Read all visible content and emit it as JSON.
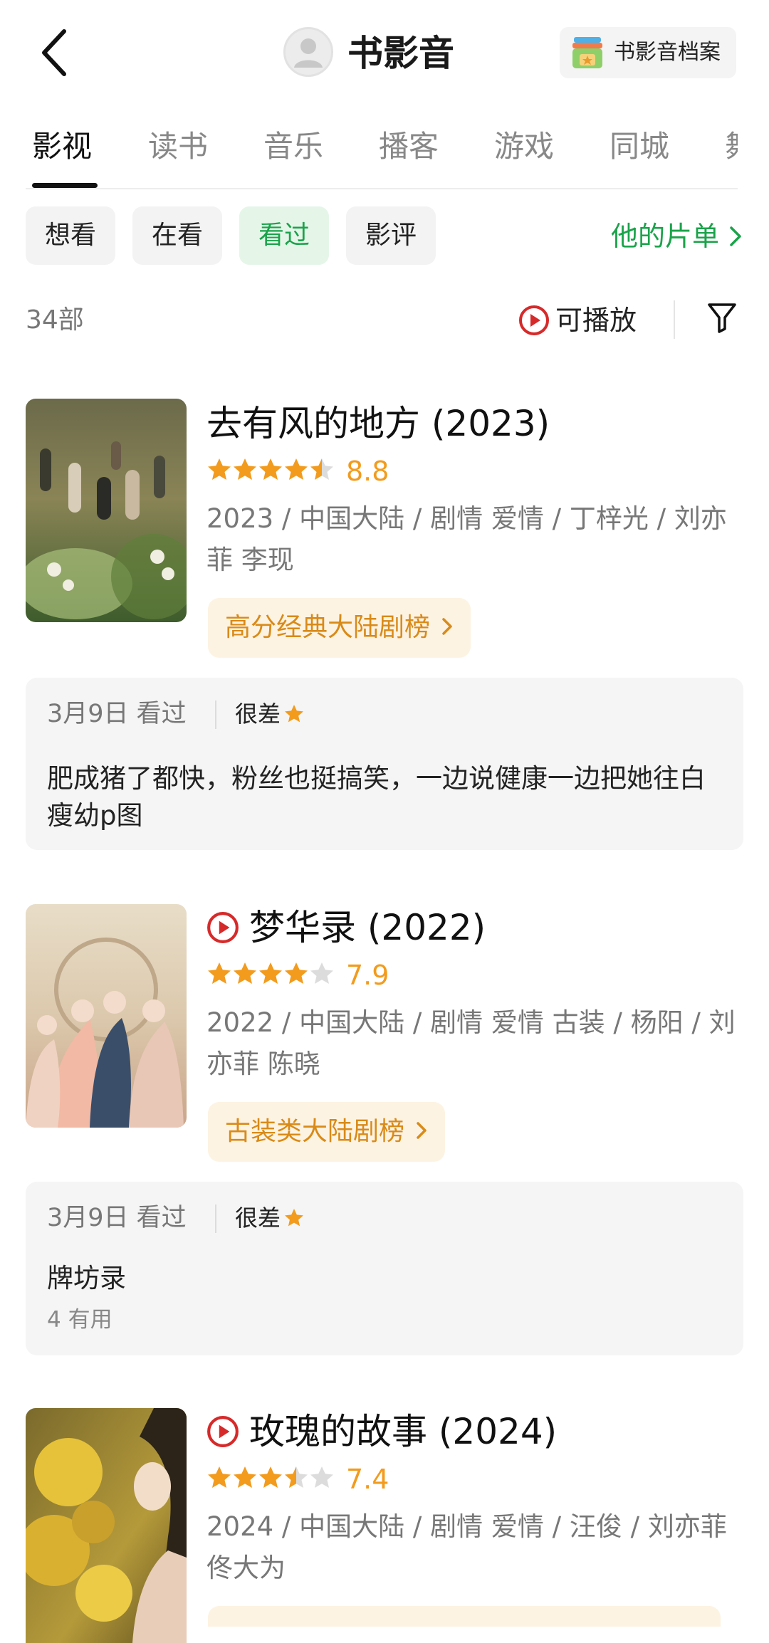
{
  "header": {
    "title": "书影音",
    "archive_label": "书影音档案"
  },
  "tabs": [
    "影视",
    "读书",
    "音乐",
    "播客",
    "游戏",
    "同城",
    "舞"
  ],
  "active_tab": "影视",
  "filters": [
    "想看",
    "在看",
    "看过",
    "影评"
  ],
  "active_filter": "看过",
  "my_list_label": "他的片单",
  "count_label": "34部",
  "playable_label": "可播放",
  "colors": {
    "accent_green": "#1aa34a",
    "star": "#f29b1d",
    "play_red": "#d62a2a",
    "rank_text": "#d98a18"
  },
  "items": [
    {
      "title": "去有风的地方 (2023)",
      "playable": false,
      "stars": 4.5,
      "rating": "8.8",
      "meta": "2023 / 中国大陆 / 剧情 爱情 / 丁梓光 / 刘亦菲 李现",
      "rank": "高分经典大陆剧榜",
      "review": {
        "date": "3月9日 看过",
        "verdict": "很差",
        "text": "肥成猪了都快，粉丝也挺搞笑，一边说健康一边把她往白瘦幼p图"
      }
    },
    {
      "title": "梦华录 (2022)",
      "playable": true,
      "stars": 4,
      "rating": "7.9",
      "meta": "2022 / 中国大陆 / 剧情 爱情 古装 / 杨阳 / 刘亦菲 陈晓",
      "rank": "古装类大陆剧榜",
      "review": {
        "date": "3月9日 看过",
        "verdict": "很差",
        "text": "牌坊录",
        "useful": "4 有用"
      }
    },
    {
      "title": "玫瑰的故事 (2024)",
      "playable": true,
      "stars": 3.5,
      "rating": "7.4",
      "meta": "2024 / 中国大陆 / 剧情 爱情 / 汪俊 / 刘亦菲 佟大为"
    }
  ]
}
